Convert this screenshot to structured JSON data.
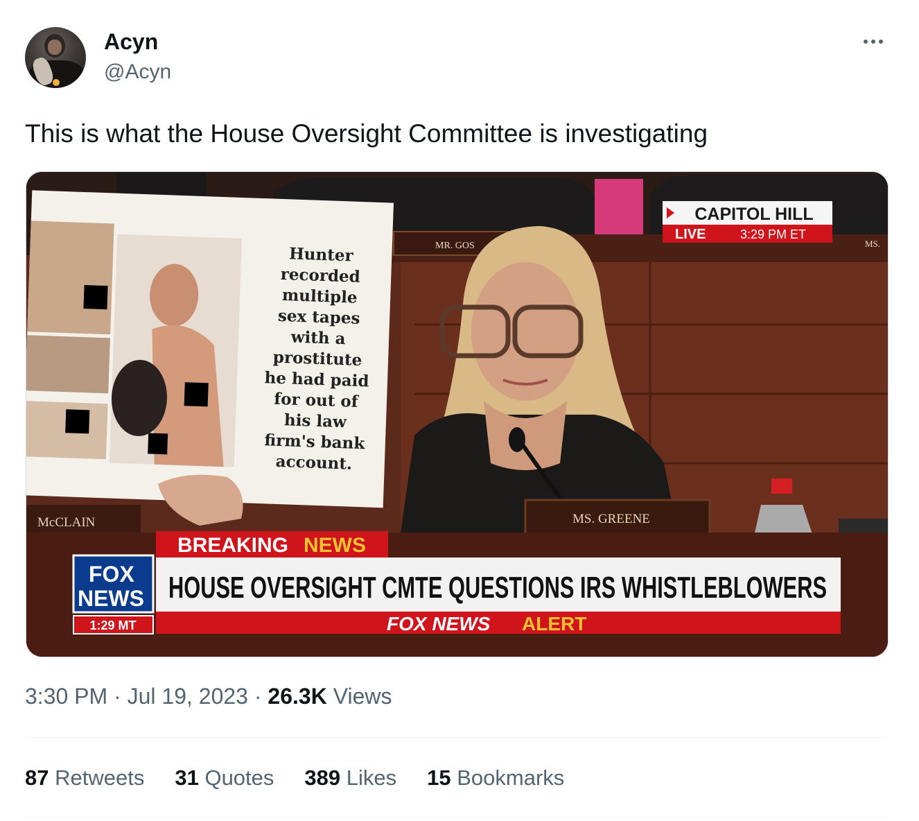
{
  "author": {
    "display_name": "Acyn",
    "handle": "@Acyn",
    "avatar": "profile-photo"
  },
  "more_icon": "more-horizontal-icon",
  "tweet_text": "This is what the House Oversight Committee is investigating",
  "media": {
    "sign_text": [
      "Hunter",
      "recorded",
      "multiple",
      "sex tapes",
      "with a",
      "prostitute",
      "he had paid",
      "for out of",
      "his law",
      "firm's bank",
      "account."
    ],
    "placards": {
      "left": "McCLAIN",
      "center": "MS. GREENE",
      "top": "MR. GOS",
      "right": "MS."
    },
    "bug": {
      "location": "CAPITOL HILL",
      "live": "LIVE",
      "time": "3:29 PM ET"
    },
    "lower_third": {
      "breaking": "BREAKING",
      "news": "NEWS",
      "headline": "HOUSE OVERSIGHT CMTE QUESTIONS IRS WHISTLEBLOWERS",
      "alert_brand": "FOX NEWS",
      "alert_word": "ALERT",
      "logo_line1": "FOX",
      "logo_line2": "NEWS",
      "logo_time": "1:29 MT"
    },
    "colors": {
      "fox_red": "#d0141c",
      "fox_blue": "#0a3b8c",
      "alert_yellow": "#f2c230"
    }
  },
  "timestamp": {
    "time": "3:30 PM",
    "separator": " · ",
    "date": "Jul 19, 2023",
    "views_count": "26.3K",
    "views_label": "Views"
  },
  "stats": [
    {
      "count": "87",
      "label": "Retweets"
    },
    {
      "count": "31",
      "label": "Quotes"
    },
    {
      "count": "389",
      "label": "Likes"
    },
    {
      "count": "15",
      "label": "Bookmarks"
    }
  ]
}
